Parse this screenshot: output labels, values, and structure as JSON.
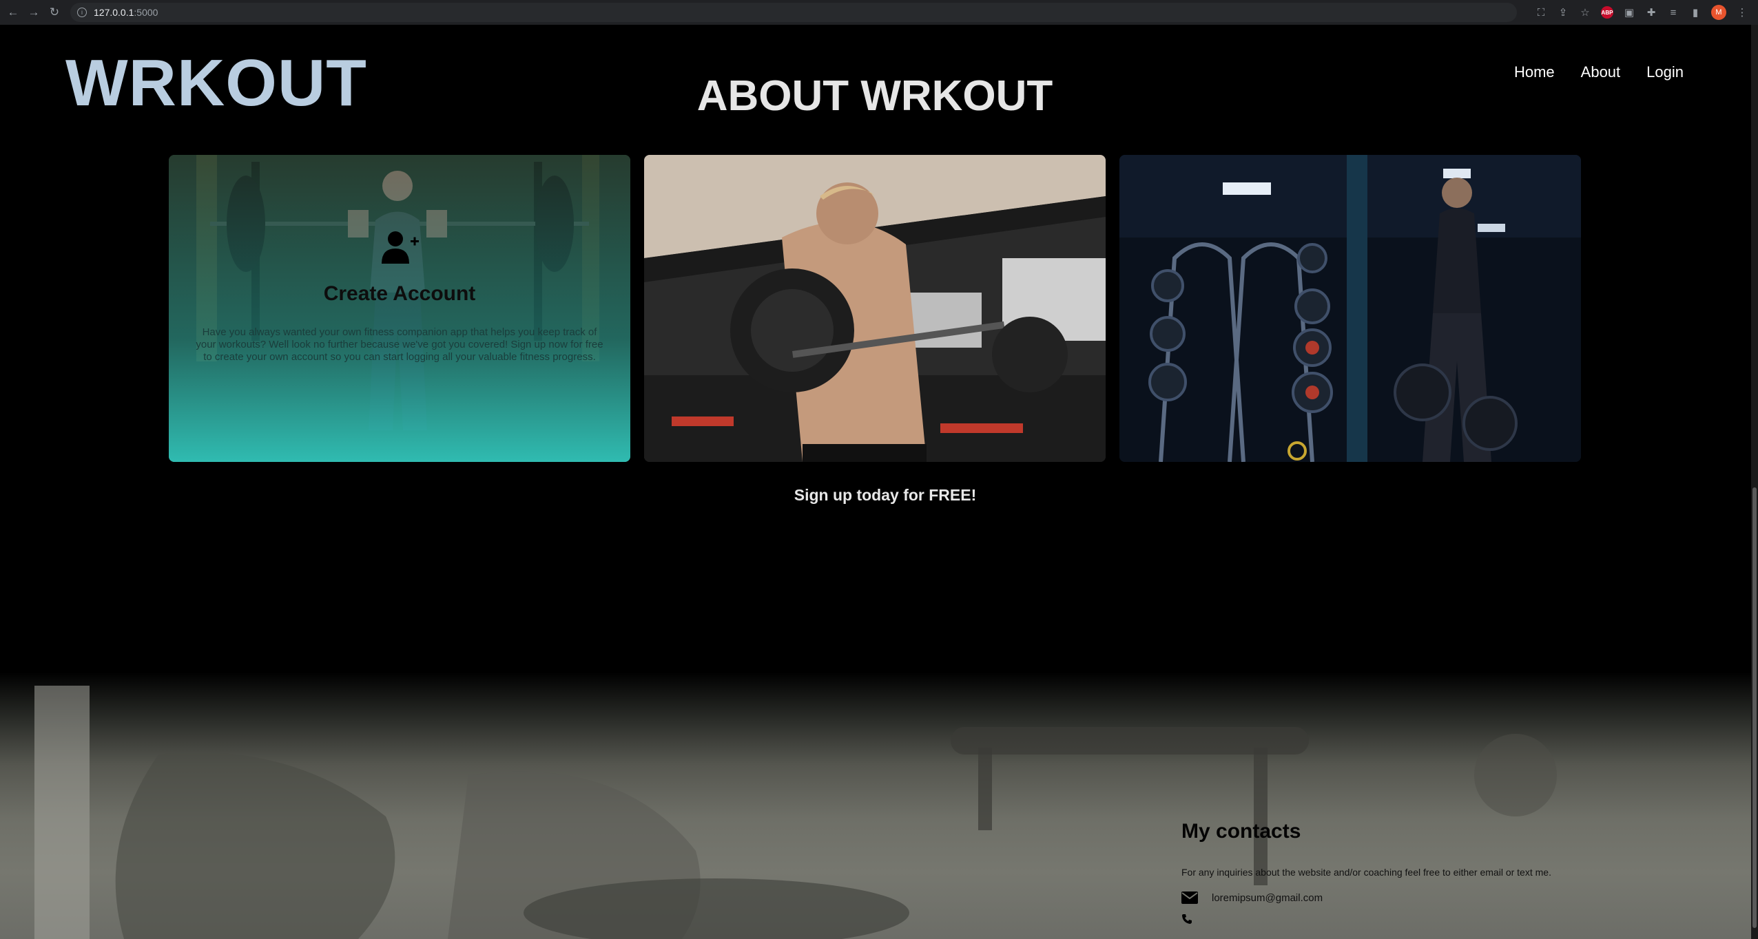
{
  "browser": {
    "url_host": "127.0.0.1",
    "url_port": ":5000",
    "avatar_letter": "M",
    "abp_label": "ABP"
  },
  "header": {
    "logo": "WRKOUT",
    "nav": [
      {
        "label": "Home"
      },
      {
        "label": "About"
      },
      {
        "label": "Login"
      }
    ]
  },
  "main": {
    "title": "ABOUT WRKOUT",
    "cards": [
      {
        "heading": "Create Account",
        "text": "Have you always wanted your own fitness companion app that helps you keep track of your workouts? Well look no further because we've got you covered! Sign up now for free to create your own account so you can start logging all your valuable fitness progress."
      }
    ],
    "signup_text": "Sign up today for FREE!"
  },
  "footer": {
    "contacts_title": "My contacts",
    "contacts_desc": "For any inquiries about the website and/or coaching feel free to either email or text me.",
    "email": "loremipsum@gmail.com"
  }
}
